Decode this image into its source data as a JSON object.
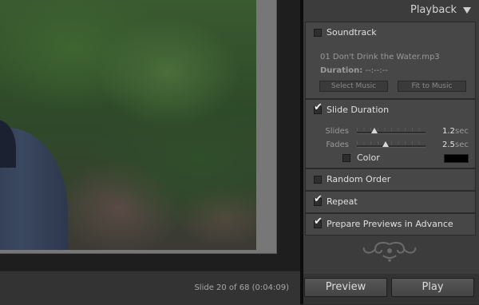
{
  "status": {
    "slide_counter": "Slide 20 of 68 (0:04:09)"
  },
  "panel": {
    "title": "Playback",
    "soundtrack": {
      "label": "Soundtrack",
      "checked": false,
      "file_name": "01 Don't Drink the Water.mp3",
      "duration_label": "Duration:",
      "duration_value": "--:--:--",
      "select_music_label": "Select Music",
      "fit_to_music_label": "Fit to Music"
    },
    "slide_duration": {
      "label": "Slide Duration",
      "checked": true,
      "slides": {
        "label": "Slides",
        "value": "1.2",
        "unit": "sec",
        "level": 0.25
      },
      "fades": {
        "label": "Fades",
        "value": "2.5",
        "unit": "sec",
        "level": 0.42
      },
      "color": {
        "label": "Color",
        "checked": false,
        "swatch": "#000000"
      }
    },
    "random_order": {
      "label": "Random Order",
      "checked": false
    },
    "repeat": {
      "label": "Repeat",
      "checked": true
    },
    "prepare_previews": {
      "label": "Prepare Previews in Advance",
      "checked": true
    }
  },
  "actions": {
    "preview_label": "Preview",
    "play_label": "Play"
  },
  "check_glyph": "✔"
}
